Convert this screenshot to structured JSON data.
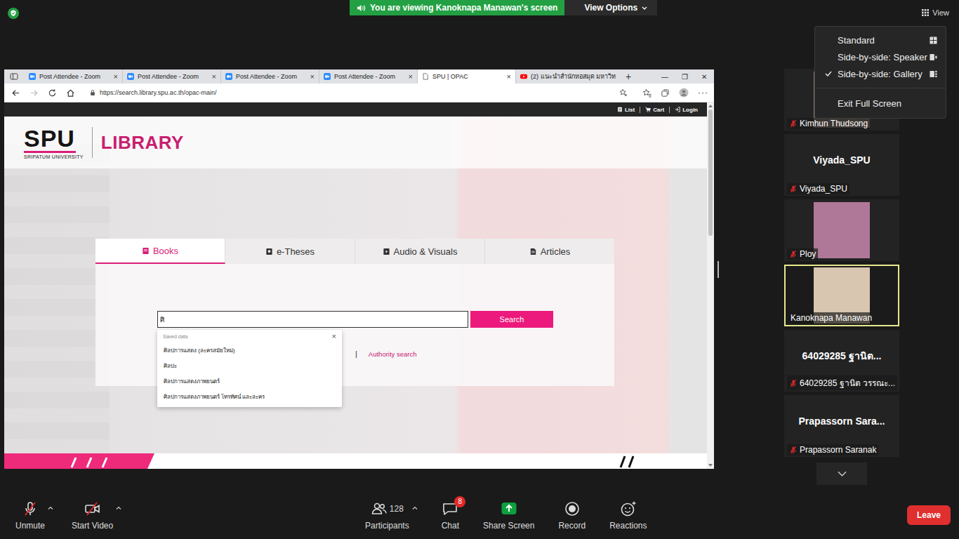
{
  "meeting": {
    "banner": "You are viewing Kanoknapa Manawan's screen",
    "view_options": "View Options",
    "view_button": "View"
  },
  "view_menu": [
    {
      "label": "Standard",
      "kind": "standard",
      "selected": false
    },
    {
      "label": "Side-by-side: Speaker",
      "kind": "speaker",
      "selected": false
    },
    {
      "label": "Side-by-side: Gallery",
      "kind": "gallery",
      "selected": true
    },
    {
      "label": "Exit Full Screen",
      "kind": "exit",
      "selected": false
    }
  ],
  "browser": {
    "tabs": [
      {
        "title": "Post Attendee - Zoom",
        "kind": "zoom",
        "selected": false,
        "closable": true
      },
      {
        "title": "Post Attendee - Zoom",
        "kind": "zoom",
        "selected": false,
        "closable": true
      },
      {
        "title": "Post Attendee - Zoom",
        "kind": "zoom",
        "selected": false,
        "closable": true
      },
      {
        "title": "Post Attendee - Zoom",
        "kind": "zoom",
        "selected": false,
        "closable": true
      },
      {
        "title": "SPU | OPAC",
        "kind": "page",
        "selected": true,
        "closable": true
      },
      {
        "title": "(2) แนะนำสำนักหอสมุด มหาวิท",
        "kind": "youtube",
        "selected": false,
        "closable": false
      }
    ],
    "tab_close": "×",
    "new_tab": "+",
    "window_controls": [
      "—",
      "❐",
      "✕"
    ],
    "url": "https://search.library.spu.ac.th/opac-main/",
    "more": "···"
  },
  "library": {
    "top_links": [
      {
        "label": "List",
        "kind": "list"
      },
      {
        "label": "Cart",
        "kind": "cart"
      },
      {
        "label": "Login",
        "kind": "login"
      }
    ],
    "logo": {
      "mark": "SPU",
      "sub": "SRIPATUM UNIVERSITY",
      "name": "LIBRARY"
    },
    "search_tabs": [
      {
        "label": "Books",
        "kind": "book",
        "selected": true
      },
      {
        "label": "e-Theses",
        "kind": "thesis",
        "selected": false
      },
      {
        "label": "Audio & Visuals",
        "kind": "av",
        "selected": false
      },
      {
        "label": "Articles",
        "kind": "article",
        "selected": false
      }
    ],
    "query": "ศิ",
    "search_button": "Search",
    "suggestions": {
      "title": "Saved data",
      "close": "×",
      "items": [
        "ศิลปการแสดง (ละครสมัยใหม่)",
        "ศิลปะ",
        "ศิลปการแสดงภาพยนตร์",
        "ศิลปการแสดงภาพยนตร์ โทรทัศน์ และละคร"
      ]
    },
    "link_separator": "|",
    "authority_link": "Authority search"
  },
  "participants": [
    {
      "label": "Kimhun Thudsong",
      "kind": "photo",
      "display": "",
      "muted": true,
      "active": false,
      "color": "#8c7c6e"
    },
    {
      "label": "Viyada_SPU",
      "kind": "name",
      "display": "Viyada_SPU",
      "muted": true,
      "active": false,
      "color": "#232323"
    },
    {
      "label": "Ploy",
      "kind": "photo",
      "display": "",
      "muted": true,
      "active": false,
      "color": "#b07898"
    },
    {
      "label": "Kanoknapa Manawan",
      "kind": "photo",
      "display": "",
      "muted": false,
      "active": true,
      "color": "#d9c6b0"
    },
    {
      "label": "64029285 ฐานิต วรรณะ...",
      "kind": "name",
      "display": "64029285 ฐานิต...",
      "muted": true,
      "active": false,
      "color": "#232323"
    },
    {
      "label": "Prapassorn Saranak",
      "kind": "name",
      "display": "Prapassorn  Sara...",
      "muted": true,
      "active": false,
      "color": "#232323"
    }
  ],
  "toolbar": {
    "left": [
      {
        "label": "Unmute",
        "kind": "mic",
        "menu": true
      },
      {
        "label": "Start Video",
        "kind": "video",
        "menu": true
      }
    ],
    "center": [
      {
        "label": "Participants",
        "kind": "participants",
        "count": "128",
        "badge": "",
        "menu": true
      },
      {
        "label": "Chat",
        "kind": "chat",
        "count": "",
        "badge": "8",
        "menu": false
      },
      {
        "label": "Share Screen",
        "kind": "share",
        "count": "",
        "badge": "",
        "menu": false
      },
      {
        "label": "Record",
        "kind": "record",
        "count": "",
        "badge": "",
        "menu": false
      },
      {
        "label": "Reactions",
        "kind": "reactions",
        "count": "",
        "badge": "",
        "menu": false
      }
    ],
    "leave": "Leave"
  }
}
